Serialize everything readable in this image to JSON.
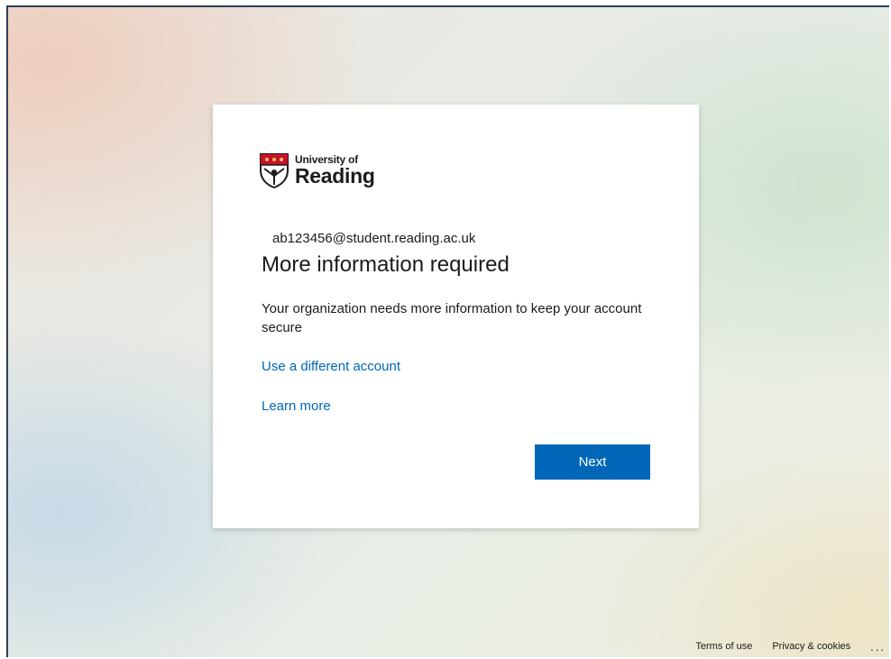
{
  "brand": {
    "name_line1": "University of",
    "name_line2": "Reading",
    "crest_colors": {
      "top": "#c8102e",
      "bottom": "#ffffff",
      "outline": "#1c1c1c",
      "accent": "#f2c94c"
    }
  },
  "identity": {
    "email": "ab123456@student.reading.ac.uk"
  },
  "prompt": {
    "title": "More information required",
    "description": "Your organization needs more information to keep your account secure",
    "use_different_account_link": "Use a different account",
    "learn_more_link": "Learn more",
    "next_button": "Next"
  },
  "footer": {
    "terms_link": "Terms of use",
    "privacy_link": "Privacy & cookies",
    "more_options": "..."
  },
  "colors": {
    "accent": "#0067b8",
    "card_bg": "#ffffff",
    "text": "#1b1b1b"
  }
}
